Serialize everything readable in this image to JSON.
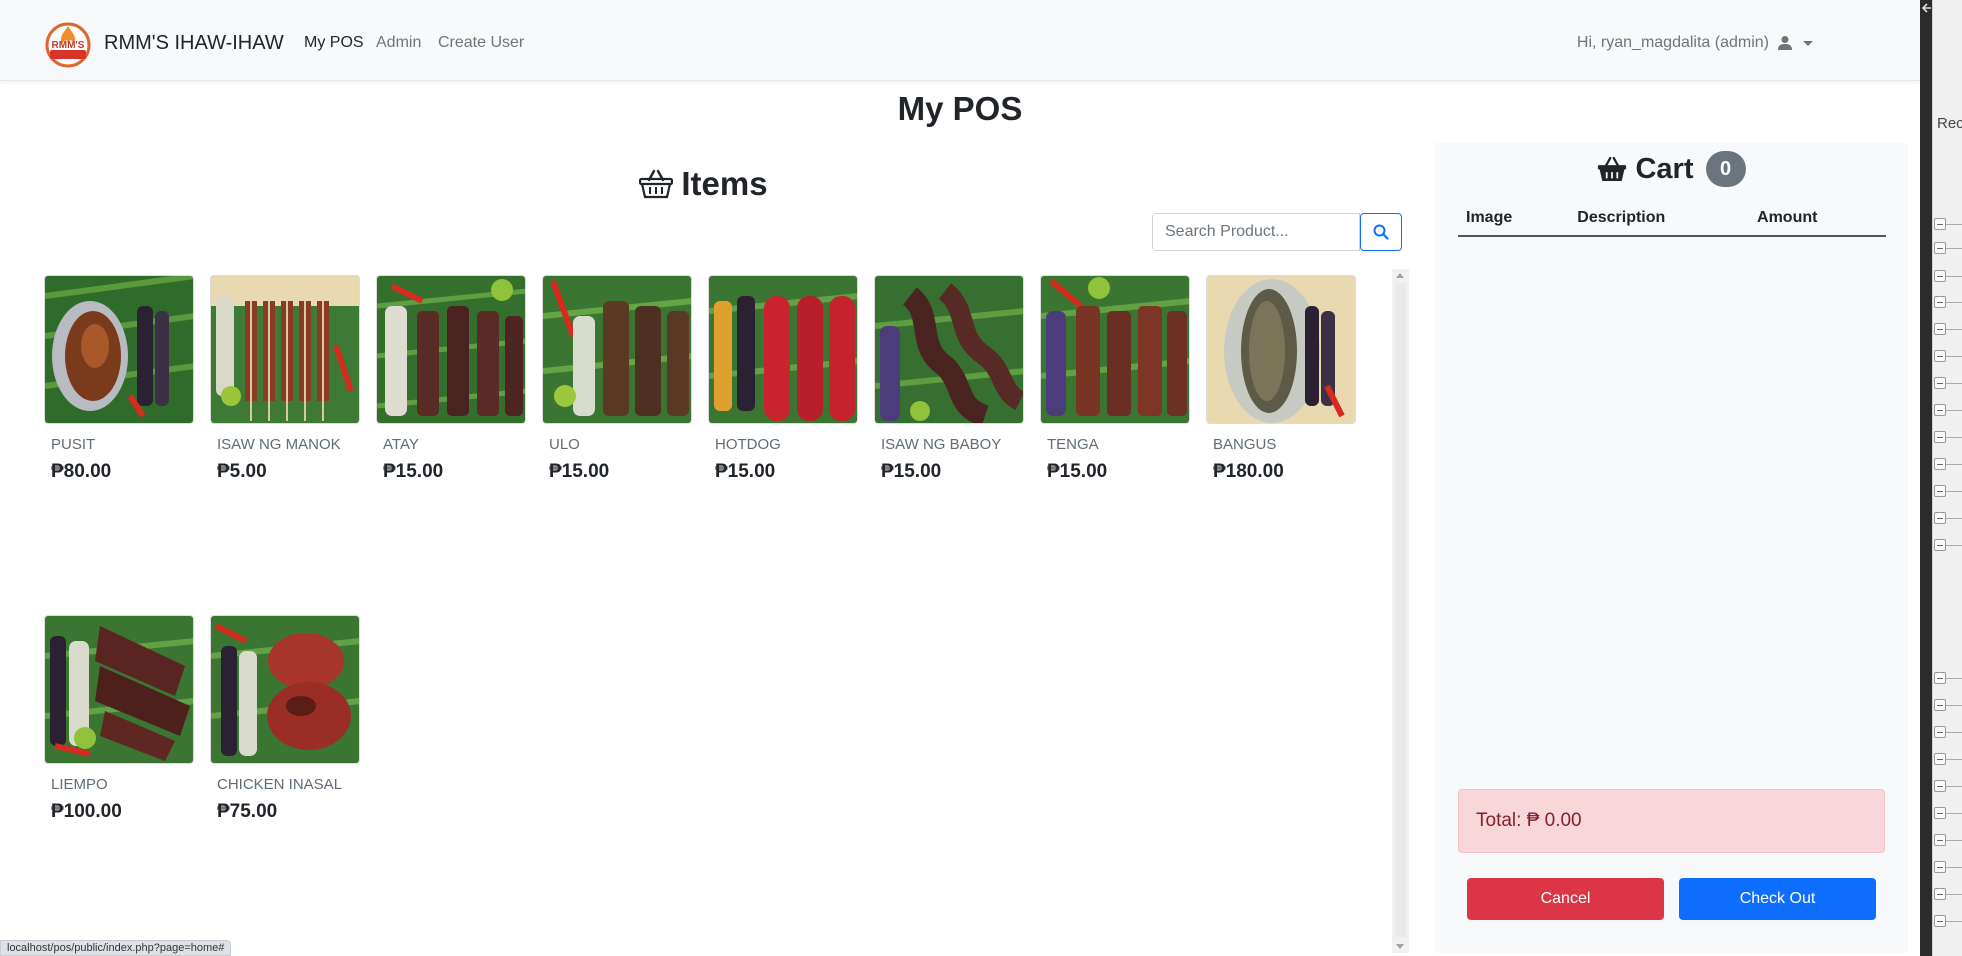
{
  "navbar": {
    "logo_text": "RMM'S",
    "brand": "RMM'S IHAW-IHAW",
    "links": [
      {
        "label": "My POS",
        "active": true
      },
      {
        "label": "Admin",
        "active": false
      },
      {
        "label": "Create User",
        "active": false
      }
    ],
    "user_greeting": "Hi, ryan_magdalita (admin)",
    "user_icon": "user-icon"
  },
  "page": {
    "title": "My POS"
  },
  "items": {
    "title": "Items",
    "title_icon": "basket-icon",
    "search": {
      "placeholder": "Search Product...",
      "value": "",
      "button_icon": "search-icon"
    },
    "products": [
      {
        "name": "PUSIT",
        "price": "₱80.00"
      },
      {
        "name": "ISAW NG MANOK",
        "price": "₱5.00"
      },
      {
        "name": "ATAY",
        "price": "₱15.00"
      },
      {
        "name": "ULO",
        "price": "₱15.00"
      },
      {
        "name": "HOTDOG",
        "price": "₱15.00"
      },
      {
        "name": "ISAW NG BABOY",
        "price": "₱15.00"
      },
      {
        "name": "TENGA",
        "price": "₱15.00"
      },
      {
        "name": "BANGUS",
        "price": "₱180.00"
      },
      {
        "name": "LIEMPO",
        "price": "₱100.00"
      },
      {
        "name": "CHICKEN INASAL",
        "price": "₱75.00"
      }
    ]
  },
  "cart": {
    "title": "Cart",
    "title_icon": "basket-icon",
    "count": "0",
    "columns": [
      "Image",
      "Description",
      "Amount"
    ],
    "total": "Total: ₱ 0.00",
    "cancel_label": "Cancel",
    "checkout_label": "Check Out"
  },
  "side_panel": {
    "partial_text": "Rec"
  },
  "status_bar": {
    "url": "localhost/pos/public/index.php?page=home#"
  },
  "colors": {
    "primary": "#0d6efd",
    "danger": "#dc3545",
    "alert_bg": "#f8d7da",
    "badge": "#6c757d"
  }
}
